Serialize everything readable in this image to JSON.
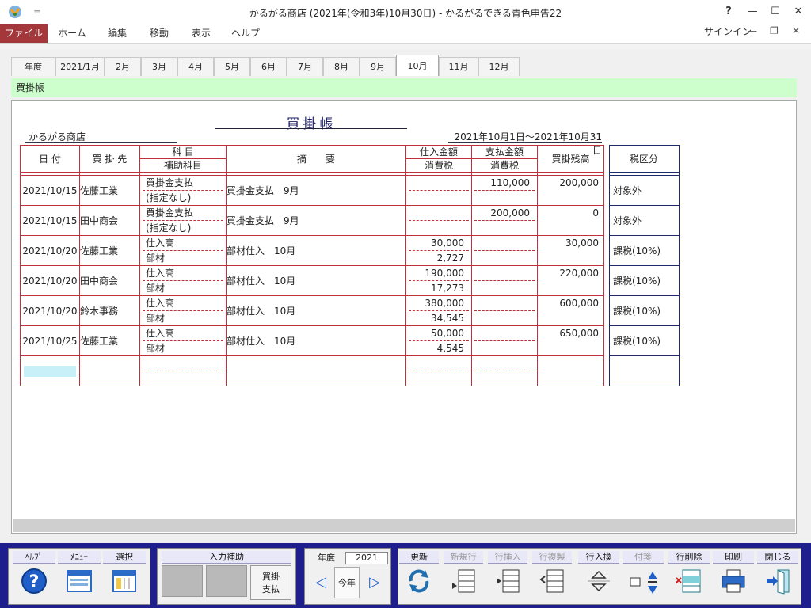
{
  "window": {
    "title": "かるがる商店 (2021年(令和3年)10月30日) - かるがるできる青色申告22",
    "help_glyph": "?",
    "minimize_glyph": "—",
    "maximize_glyph": "☐",
    "close_glyph": "✕",
    "qa_glyph": "＝"
  },
  "menu": {
    "items": [
      "ファイル",
      "ホーム",
      "編集",
      "移動",
      "表示",
      "ヘルプ"
    ],
    "signin": "サインイン",
    "ribbon_min_glyph": "—",
    "ribbon_restore_glyph": "❐",
    "ribbon_close_glyph": "✕"
  },
  "tabs": [
    "年度",
    "2021/1月",
    "2月",
    "3月",
    "4月",
    "5月",
    "6月",
    "7月",
    "8月",
    "9月",
    "10月",
    "11月",
    "12月"
  ],
  "active_tab": "10月",
  "banner": "買掛帳",
  "ledger": {
    "title": "買掛帳",
    "company": "かるがる商店",
    "period": "2021年10月1日～2021年10月31日",
    "headers": {
      "date": "日 付",
      "vendor": "買 掛 先",
      "account": "科 目",
      "sub_account": "補助科目",
      "description": "摘　　要",
      "purchase": "仕入金額",
      "purchase_tax": "消費税",
      "payment": "支払金額",
      "payment_tax": "消費税",
      "balance": "買掛残高"
    },
    "rows": [
      {
        "date": "2021/10/15",
        "vendor": "佐藤工業",
        "account": "買掛金支払",
        "sub_account": "(指定なし)",
        "description": "買掛金支払　9月",
        "purchase": "",
        "purchase_tax": "",
        "payment": "110,000",
        "payment_tax": "",
        "balance": "200,000",
        "tax": "対象外"
      },
      {
        "date": "2021/10/15",
        "vendor": "田中商会",
        "account": "買掛金支払",
        "sub_account": "(指定なし)",
        "description": "買掛金支払　9月",
        "purchase": "",
        "purchase_tax": "",
        "payment": "200,000",
        "payment_tax": "",
        "balance": "0",
        "tax": "対象外"
      },
      {
        "date": "2021/10/20",
        "vendor": "佐藤工業",
        "account": "仕入高",
        "sub_account": "部材",
        "description": "部材仕入　10月",
        "purchase": "30,000",
        "purchase_tax": "2,727",
        "payment": "",
        "payment_tax": "",
        "balance": "30,000",
        "tax": "課税(10%)"
      },
      {
        "date": "2021/10/20",
        "vendor": "田中商会",
        "account": "仕入高",
        "sub_account": "部材",
        "description": "部材仕入　10月",
        "purchase": "190,000",
        "purchase_tax": "17,273",
        "payment": "",
        "payment_tax": "",
        "balance": "220,000",
        "tax": "課税(10%)"
      },
      {
        "date": "2021/10/20",
        "vendor": "鈴木事務",
        "account": "仕入高",
        "sub_account": "部材",
        "description": "部材仕入　10月",
        "purchase": "380,000",
        "purchase_tax": "34,545",
        "payment": "",
        "payment_tax": "",
        "balance": "600,000",
        "tax": "課税(10%)"
      },
      {
        "date": "2021/10/25",
        "vendor": "佐藤工業",
        "account": "仕入高",
        "sub_account": "部材",
        "description": "部材仕入　10月",
        "purchase": "50,000",
        "purchase_tax": "4,545",
        "payment": "",
        "payment_tax": "",
        "balance": "650,000",
        "tax": "課税(10%)"
      }
    ],
    "tax_header": "税区分"
  },
  "toolbar": {
    "help": "ﾍﾙﾌﾟ",
    "menu": "ﾒﾆｭｰ",
    "select": "選択",
    "input_assist": "入力補助",
    "assist_btn_line1": "買掛",
    "assist_btn_line2": "支払",
    "year_label": "年度",
    "year_value": "2021",
    "this_year": "今年",
    "prev_glyph": "◁",
    "next_glyph": "▷",
    "update": "更新",
    "new_row": "新規行",
    "insert_row": "行挿入",
    "copy_row": "行複製",
    "swap_row": "行入換",
    "tag": "付箋",
    "delete_row": "行削除",
    "print": "印刷",
    "close": "閉じる"
  }
}
